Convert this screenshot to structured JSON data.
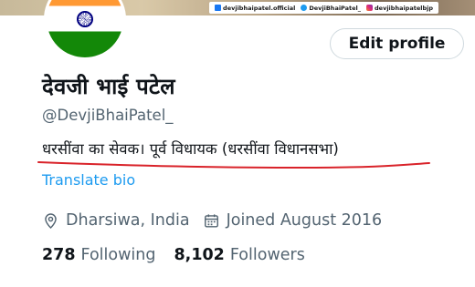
{
  "banner": {
    "social": [
      {
        "icon": "facebook-icon",
        "label": "devjibhaipatel.official"
      },
      {
        "icon": "twitter-icon",
        "label": "DevjiBhaiPatel_"
      },
      {
        "icon": "instagram-icon",
        "label": "devjibhaipatelbjp"
      }
    ]
  },
  "avatar": {
    "flag_colors": [
      "#ff9933",
      "#ffffff",
      "#138808"
    ],
    "chakra_color": "#000080"
  },
  "header": {
    "edit_label": "Edit profile"
  },
  "profile": {
    "name": "देवजी भाई पटेल",
    "handle": "@DevjiBhaiPatel_",
    "bio": "धरसींवा का सेवक। पूर्व विधायक (धरसींवा विधानसभा)",
    "translate_label": "Translate bio",
    "location": "Dharsiwa, India",
    "joined": "Joined August 2016",
    "location_icon": "location-pin-icon",
    "joined_icon": "calendar-icon"
  },
  "stats": {
    "following_count": "278",
    "following_label": "Following",
    "followers_count": "8,102",
    "followers_label": "Followers"
  },
  "colors": {
    "accent": "#1d9bf0",
    "secondary_text": "#536471",
    "primary_text": "#0f1419",
    "annotation_line": "#d9232a"
  }
}
